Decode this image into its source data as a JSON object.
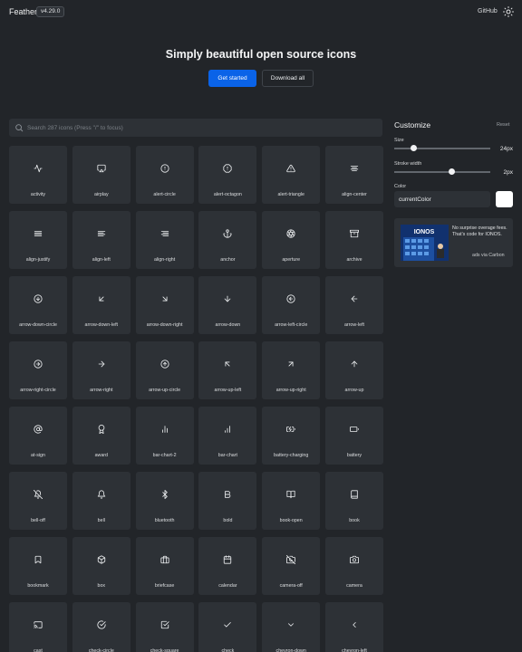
{
  "header": {
    "logo": "Feather",
    "version": "v4.29.0",
    "github": "GitHub"
  },
  "hero": {
    "title": "Simply beautiful open source icons",
    "primary": "Get started",
    "secondary": "Download all"
  },
  "search": {
    "placeholder": "Search 287 icons (Press \"/\" to focus)"
  },
  "icons": [
    "activity",
    "airplay",
    "alert-circle",
    "alert-octagon",
    "alert-triangle",
    "align-center",
    "align-justify",
    "align-left",
    "align-right",
    "anchor",
    "aperture",
    "archive",
    "arrow-down-circle",
    "arrow-down-left",
    "arrow-down-right",
    "arrow-down",
    "arrow-left-circle",
    "arrow-left",
    "arrow-right-circle",
    "arrow-right",
    "arrow-up-circle",
    "arrow-up-left",
    "arrow-up-right",
    "arrow-up",
    "at-sign",
    "award",
    "bar-chart-2",
    "bar-chart",
    "battery-charging",
    "battery",
    "bell-off",
    "bell",
    "bluetooth",
    "bold",
    "book-open",
    "book",
    "bookmark",
    "box",
    "briefcase",
    "calendar",
    "camera-off",
    "camera",
    "cast",
    "check-circle",
    "check-square",
    "check",
    "chevron-down",
    "chevron-left"
  ],
  "customize": {
    "title": "Customize",
    "reset": "Reset",
    "size_label": "Size",
    "size_value": "24px",
    "size_fraction": 0.2,
    "stroke_label": "Stroke width",
    "stroke_value": "2px",
    "stroke_fraction": 0.6,
    "color_label": "Color",
    "color_value": "currentColor",
    "swatch_color": "#ffffff"
  },
  "ad": {
    "brand": "IONOS",
    "text": "No surprise overage fees. That's code for IONOS.",
    "via": "ads via Carbon"
  },
  "colors": {
    "background": "#222529",
    "tile": "#2d3136",
    "accent": "#0a63e8"
  }
}
